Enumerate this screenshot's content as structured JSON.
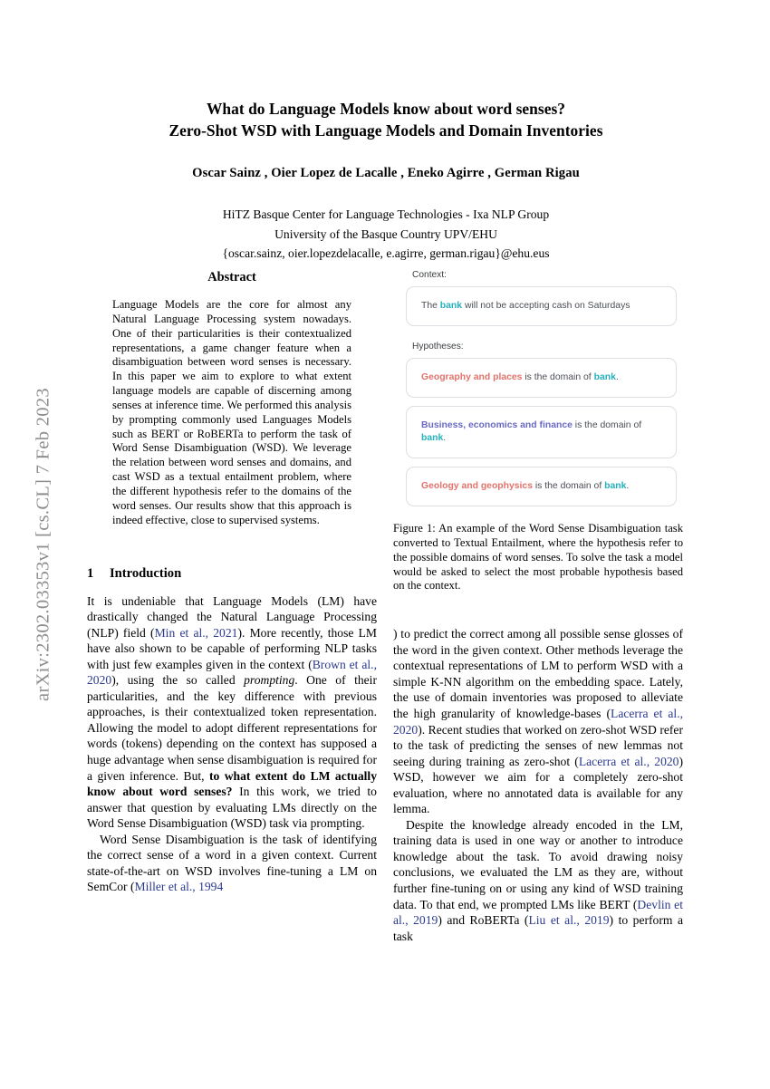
{
  "arxiv_stamp": "arXiv:2302.03353v1  [cs.CL]  7 Feb 2023",
  "title": {
    "line1": "What do Language Models know about word senses?",
    "line2": "Zero-Shot WSD with Language Models and Domain Inventories"
  },
  "authors": "Oscar Sainz , Oier Lopez de Lacalle , Eneko Agirre , German Rigau",
  "affiliation": {
    "line1": "HiTZ Basque Center for Language Technologies - Ixa NLP Group",
    "line2": "University of the Basque Country UPV/EHU",
    "line3": "{oscar.sainz, oier.lopezdelacalle, e.agirre, german.rigau}@ehu.eus"
  },
  "abstract": {
    "heading": "Abstract",
    "text": "Language Models are the core for almost any Natural Language Processing system nowadays. One of their particularities is their contextualized representations, a game changer feature when a disambiguation between word senses is necessary. In this paper we aim to explore to what extent language models are capable of discerning among senses at inference time. We performed this analysis by prompting commonly used Languages Models such as BERT or RoBERTa to perform the task of Word Sense Disambiguation (WSD). We leverage the relation between word senses and domains, and cast WSD as a textual entailment problem, where the different hypothesis refer to the domains of the word senses. Our results show that this approach is indeed effective, close to supervised systems."
  },
  "figure": {
    "context_label": "Context:",
    "hypotheses_label": "Hypotheses:",
    "context": {
      "pre": "The ",
      "token": "bank",
      "post": " will not be accepting cash on Saturdays"
    },
    "hypotheses": [
      {
        "domain": "Geography and places",
        "domain_color": "red",
        "mid": " is the domain of ",
        "token": "bank",
        "end": "."
      },
      {
        "domain": "Business, economics and finance",
        "domain_color": "blue",
        "mid": " is the domain of ",
        "token": "bank",
        "end": "."
      },
      {
        "domain": "Geology and geophysics",
        "domain_color": "red",
        "mid": " is the domain of ",
        "token": "bank",
        "end": "."
      }
    ],
    "caption": "Figure 1: An example of the Word Sense Disambiguation task converted to Textual Entailment, where the hypothesis refer to the possible domains of word senses. To solve the task a model would be asked to select the most probable hypothesis based on the context."
  },
  "section": {
    "number": "1",
    "heading": "Introduction"
  },
  "intro": {
    "p1_a": "It is undeniable that Language Models (LM) have drastically changed the Natural Language Processing (NLP) field (",
    "p1_cite1": "Min et al., 2021",
    "p1_b": "). More recently, those LM have also shown to be capable of performing NLP tasks with just few examples given in the context (",
    "p1_cite2": "Brown et al., 2020",
    "p1_c": "), using the so called ",
    "p1_em": "prompting",
    "p1_d": ". One of their particularities, and the key difference with previous approaches, is their contextualized token representation. Allowing the model to adopt different representations for words (tokens) depending on the context has supposed a huge advantage when sense disambiguation is required for a given inference. But, ",
    "p1_bold": "to what extent do LM actually know about word senses?",
    "p1_e": " In this work, we tried to answer that question by evaluating LMs directly on the Word Sense Disambiguation (WSD) task via prompting.",
    "p2_a": "Word Sense Disambiguation is the task of identifying the correct sense of a word in a given context. Current state-of-the-art on WSD involves fine-tuning a LM on SemCor (",
    "p2_cite1": "Miller et al., 1994",
    "p2_b": ") to predict the correct among all possible sense glosses of the word in the given context. Other methods leverage the contextual representations of LM to perform WSD with a simple K-NN algorithm on the embedding space. Lately, the use of domain inventories was proposed to alleviate the high granularity of knowledge-bases (",
    "p2_cite2": "Lacerra et al., 2020",
    "p2_c": "). Recent studies that worked on zero-shot WSD refer to the task of predicting the senses of new lemmas not seeing during training as zero-shot (",
    "p2_cite3": "Lacerra et al., 2020",
    "p2_d": ") WSD, however we aim for a completely zero-shot evaluation, where no annotated data is available for any lemma.",
    "p3_a": "Despite the knowledge already encoded in the LM, training data is used in one way or another to introduce knowledge about the task. To avoid drawing noisy conclusions, we evaluated the LM as they are, without further fine-tuning on or using any kind of WSD training data. To that end, we prompted LMs like BERT (",
    "p3_cite1": "Devlin et al., 2019",
    "p3_b": ") and RoBERTa (",
    "p3_cite2": "Liu et al., 2019",
    "p3_c": ") to perform a task"
  }
}
